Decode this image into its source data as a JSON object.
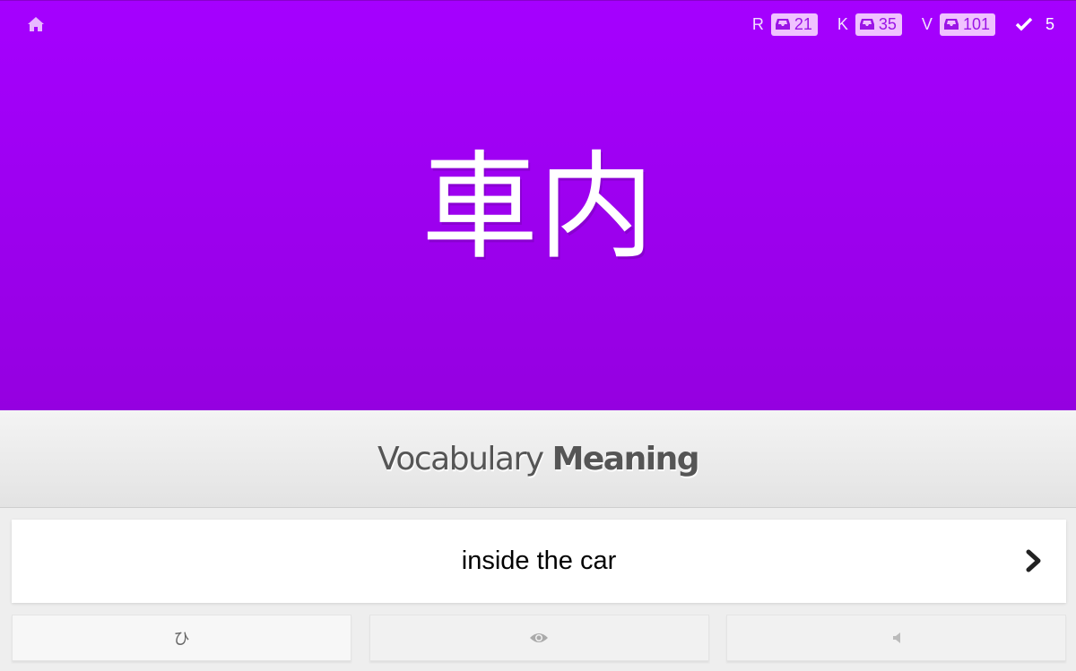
{
  "header": {
    "home_icon": "home-icon",
    "counters": [
      {
        "letter": "R",
        "icon": "inbox-icon",
        "count": "21"
      },
      {
        "letter": "K",
        "icon": "inbox-icon",
        "count": "35"
      },
      {
        "letter": "V",
        "icon": "inbox-icon",
        "count": "101"
      }
    ],
    "completed": {
      "icon": "check-icon",
      "count": "5"
    }
  },
  "card": {
    "character": "車内",
    "background_color": "#a000f2"
  },
  "prompt": {
    "type_label": "Vocabulary",
    "question_label": "Meaning"
  },
  "answer": {
    "value": "inside the car",
    "submit_icon": "chevron-right-icon"
  },
  "toolbar": {
    "kana_label": "ひ",
    "info_icon": "eye-icon",
    "audio_icon": "speaker-icon"
  }
}
